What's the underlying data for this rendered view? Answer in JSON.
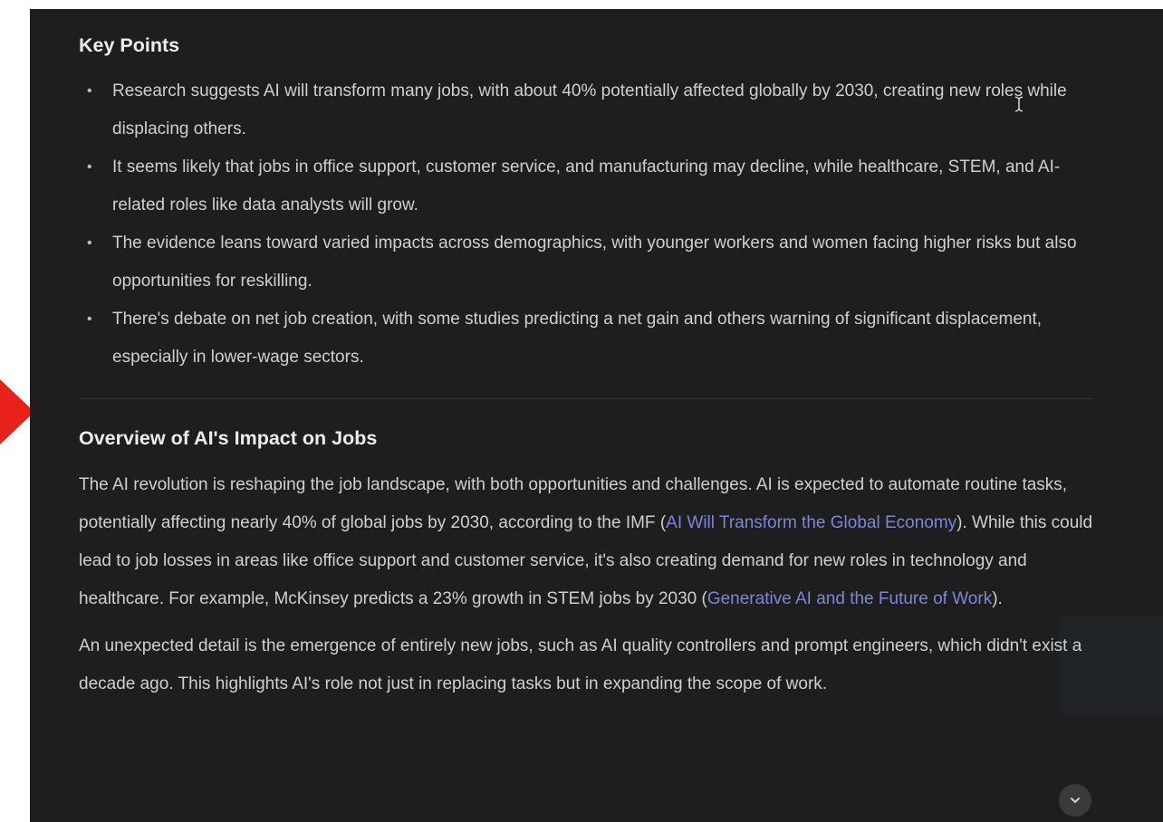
{
  "key_points": {
    "heading": "Key Points",
    "items": [
      "Research suggests AI will transform many jobs, with about 40% potentially affected globally by 2030, creating new roles while displacing others.",
      "It seems likely that jobs in office support, customer service, and manufacturing may decline, while healthcare, STEM, and AI-related roles like data analysts will grow.",
      "The evidence leans toward varied impacts across demographics, with younger workers and women facing higher risks but also opportunities for reskilling.",
      "There's debate on net job creation, with some studies predicting a net gain and others warning of significant displacement, especially in lower-wage sectors."
    ]
  },
  "overview": {
    "heading": "Overview of AI's Impact on Jobs",
    "p1_text_a": "The AI revolution is reshaping the job landscape, with both opportunities and challenges. AI is expected to automate routine tasks, potentially affecting nearly 40% of global jobs by 2030, according to the IMF (",
    "p1_link_1": "AI Will Transform the Global Economy",
    "p1_text_b": "). While this could lead to job losses in areas like office support and customer service, it's also creating demand for new roles in technology and healthcare. For example, McKinsey predicts a 23% growth in STEM jobs by 2030 (",
    "p1_link_2": "Generative AI and the Future of Work",
    "p1_text_c": ").",
    "p2_text": "An unexpected detail is the emergence of entirely new jobs, such as AI quality controllers and prompt engineers, which didn't exist a decade ago. This highlights AI's role not just in replacing tasks but in expanding the scope of work."
  },
  "icons": {
    "bullet": "•",
    "cursor": "text-cursor-icon",
    "scroll": "chevron-down-icon"
  },
  "colors": {
    "panel_bg": "#1e1e1e",
    "link": "#7c86d8",
    "marker": "#e8221b"
  }
}
